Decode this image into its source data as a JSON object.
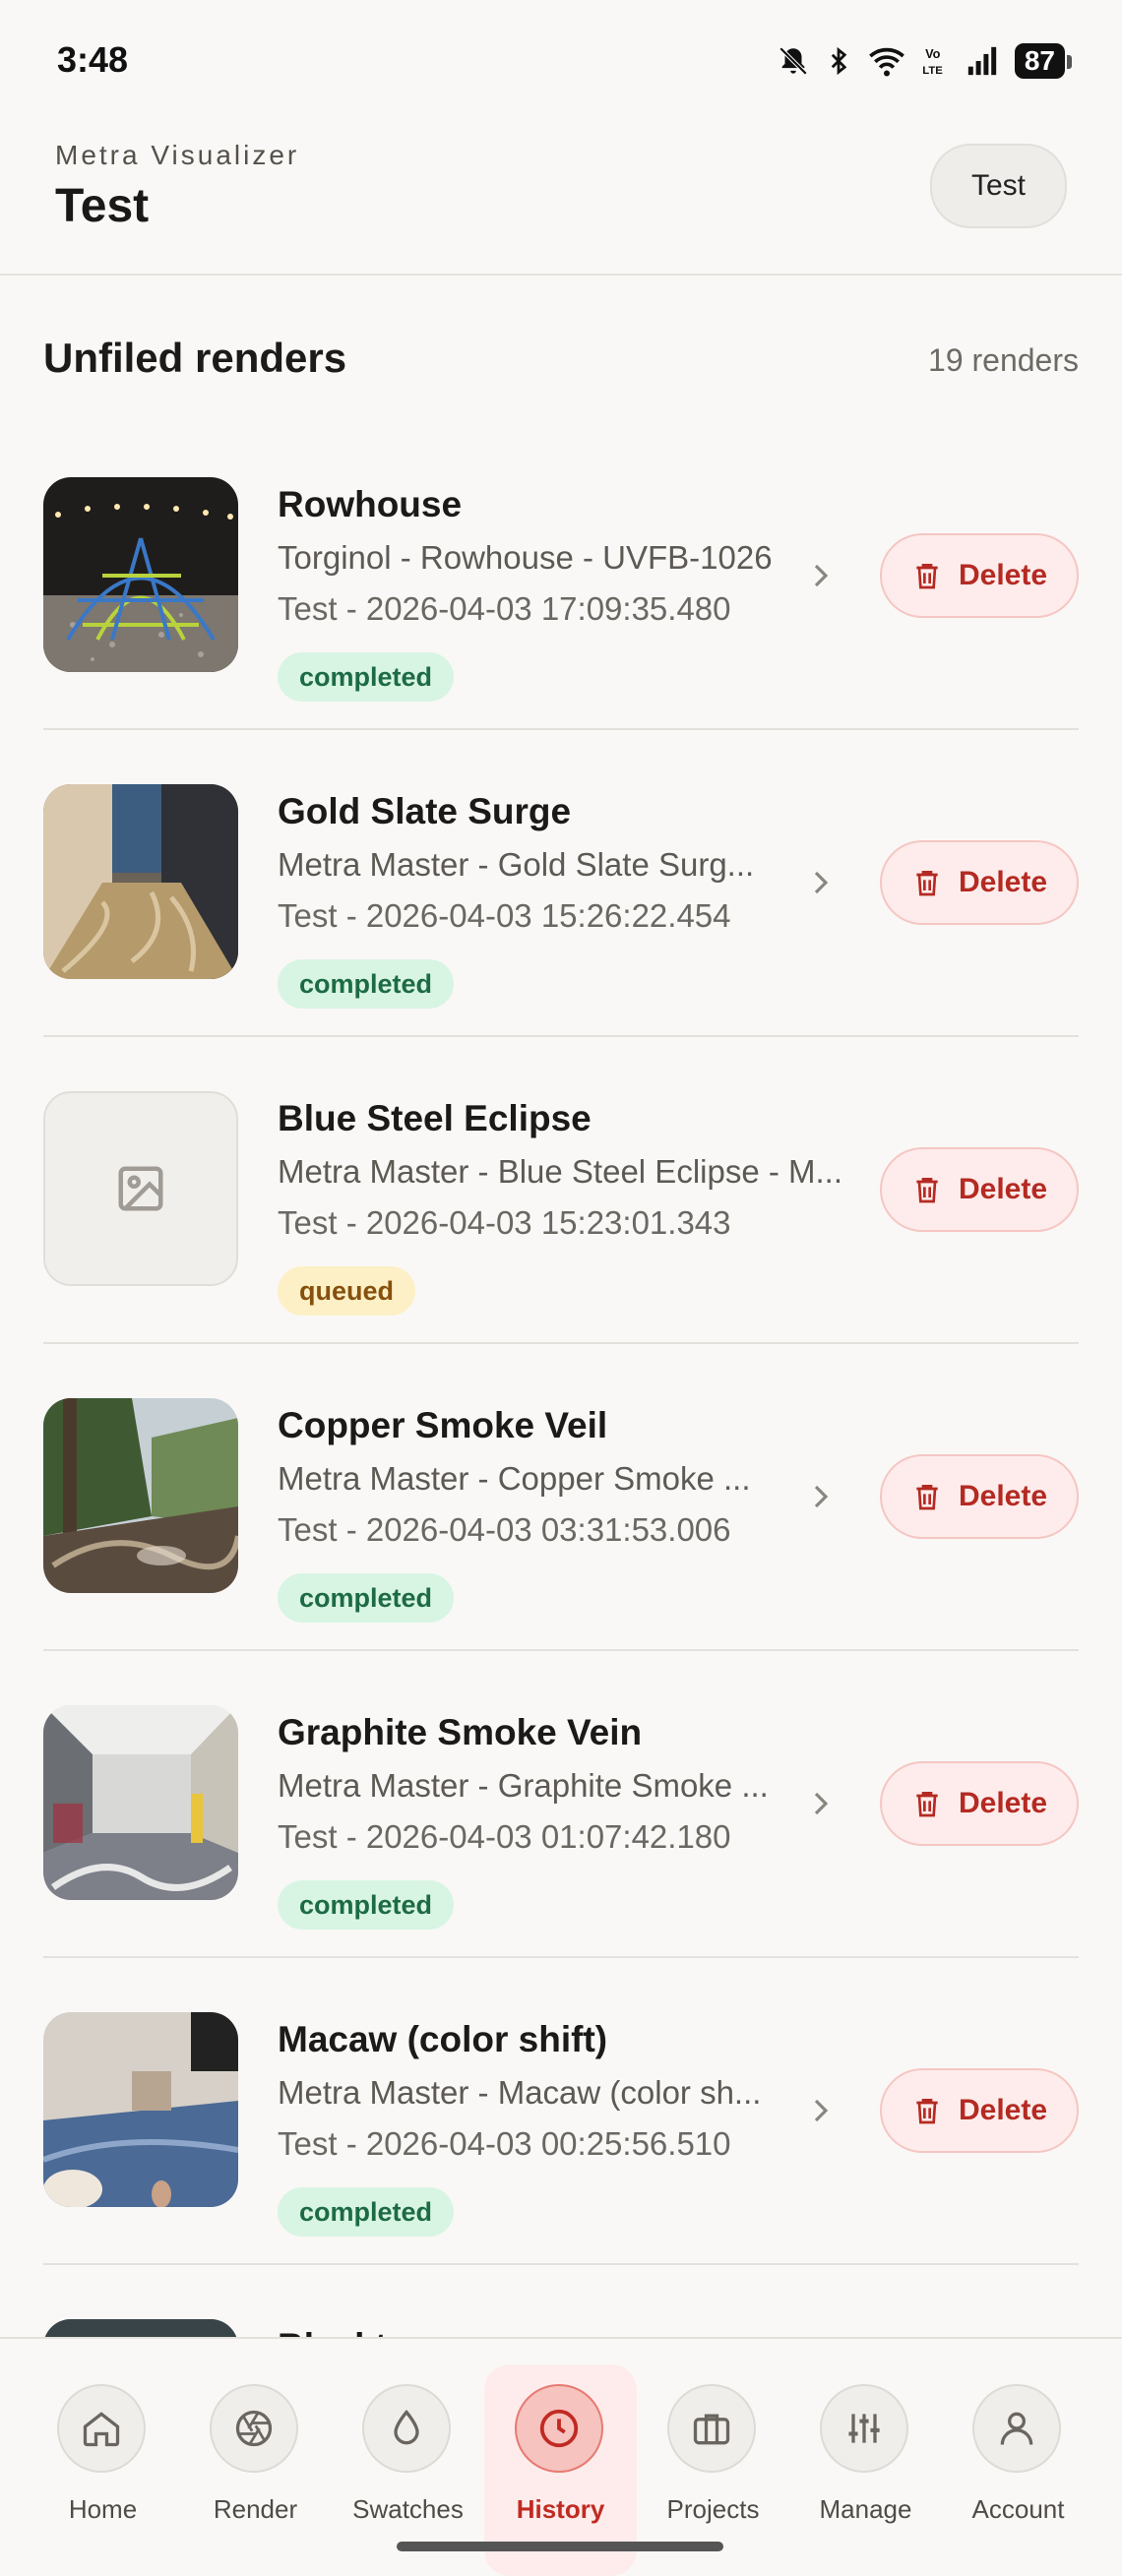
{
  "status_bar": {
    "time": "3:48",
    "battery": "87"
  },
  "header": {
    "subtitle": "Metra Visualizer",
    "title": "Test",
    "user_chip": "Test"
  },
  "section": {
    "title": "Unfiled renders",
    "count": "19 renders"
  },
  "renders": [
    {
      "title": "Rowhouse",
      "subtitle": "Torginol - Rowhouse - UVFB-1026",
      "meta": "Test - 2026-04-03 17:09:35.480",
      "status": "completed",
      "delete_label": "Delete"
    },
    {
      "title": "Gold Slate Surge",
      "subtitle": "Metra Master - Gold Slate Surg...",
      "meta": "Test - 2026-04-03 15:26:22.454",
      "status": "completed",
      "delete_label": "Delete"
    },
    {
      "title": "Blue Steel Eclipse",
      "subtitle": "Metra Master - Blue Steel Eclipse - M...",
      "meta": "Test - 2026-04-03 15:23:01.343",
      "status": "queued",
      "delete_label": "Delete"
    },
    {
      "title": "Copper Smoke Veil",
      "subtitle": "Metra Master - Copper Smoke ...",
      "meta": "Test - 2026-04-03 03:31:53.006",
      "status": "completed",
      "delete_label": "Delete"
    },
    {
      "title": "Graphite Smoke Vein",
      "subtitle": "Metra Master - Graphite Smoke ...",
      "meta": "Test - 2026-04-03 01:07:42.180",
      "status": "completed",
      "delete_label": "Delete"
    },
    {
      "title": "Macaw (color shift)",
      "subtitle": "Metra Master - Macaw (color sh...",
      "meta": "Test - 2026-04-03 00:25:56.510",
      "status": "completed",
      "delete_label": "Delete"
    },
    {
      "title": "Blacktop"
    }
  ],
  "nav": {
    "items": [
      {
        "label": "Home",
        "icon": "home-icon"
      },
      {
        "label": "Render",
        "icon": "aperture-icon"
      },
      {
        "label": "Swatches",
        "icon": "droplet-icon"
      },
      {
        "label": "History",
        "icon": "clock-icon"
      },
      {
        "label": "Projects",
        "icon": "briefcase-icon"
      },
      {
        "label": "Manage",
        "icon": "sliders-icon"
      },
      {
        "label": "Account",
        "icon": "user-icon"
      }
    ],
    "active": "History"
  },
  "colors": {
    "accent": "#c12a22",
    "completed_bg": "#d8f5e3",
    "queued_bg": "#fdf0c6"
  }
}
